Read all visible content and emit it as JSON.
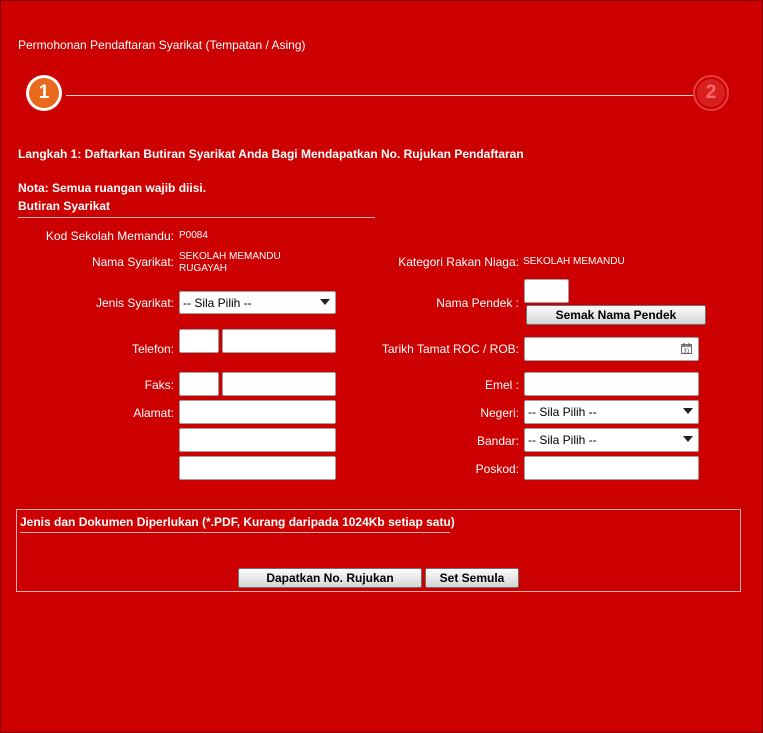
{
  "page_title": "Permohonan Pendaftaran Syarikat (Tempatan / Asing)",
  "steps": [
    {
      "number": "1",
      "active": true
    },
    {
      "number": "2",
      "active": false
    }
  ],
  "step_heading": "Langkah 1: Daftarkan Butiran Syarikat Anda Bagi Mendapatkan No. Rujukan Pendaftaran",
  "note": "Nota: Semua ruangan wajib diisi.",
  "section_title": "Butiran Syarikat",
  "form": {
    "kod_label": "Kod Sekolah Memandu:",
    "kod_value": "P0084",
    "nama_label": "Nama Syarikat:",
    "nama_value_line1": "SEKOLAH MEMANDU",
    "nama_value_line2": "RUGAYAH",
    "kategori_label": "Kategori Rakan Niaga:",
    "kategori_value": "SEKOLAH MEMANDU",
    "jenis_label": "Jenis Syarikat:",
    "jenis_value": "-- Sila Pilih --",
    "nama_pendek_label": "Nama Pendek :",
    "semak_button": "Semak Nama Pendek",
    "telefon_label": "Telefon:",
    "tarikh_label": "Tarikh Tamat ROC / ROB:",
    "faks_label": "Faks:",
    "emel_label": "Emel :",
    "alamat_label": "Alamat:",
    "negeri_label": "Negeri:",
    "negeri_value": "-- Sila Pilih --",
    "bandar_label": "Bandar:",
    "bandar_value": "-- Sila Pilih --",
    "poskod_label": "Poskod:",
    "calendar_day": "31"
  },
  "documents": {
    "title": "Jenis dan Dokumen Diperlukan (*.PDF, Kurang daripada 1024Kb setiap satu)",
    "submit_button": "Dapatkan No. Rujukan",
    "reset_button": "Set Semula"
  },
  "colors": {
    "background": "#cc0000",
    "step_active": "#e86a1a",
    "step_inactive": "#d82020"
  },
  "icons": {
    "calendar": "calendar-icon",
    "dropdown": "chevron-down-icon"
  }
}
